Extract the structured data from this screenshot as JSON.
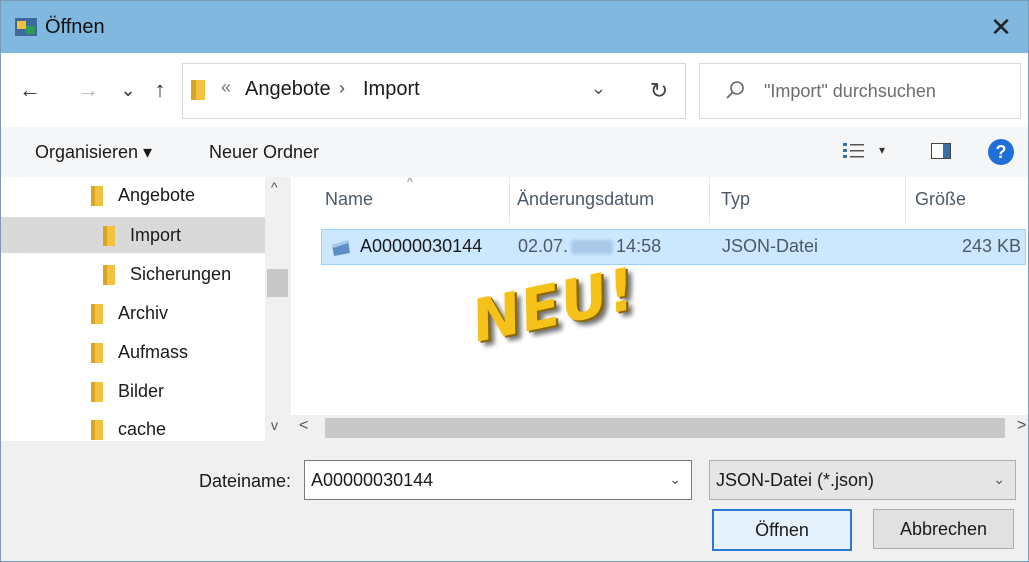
{
  "window": {
    "title": "Öffnen",
    "close_glyph": "✕"
  },
  "addressbar": {
    "back": "←",
    "forward": "→",
    "recent": "⌄",
    "up": "↑",
    "overflow": "«",
    "path": [
      "Angebote",
      "Import"
    ],
    "separator": "›",
    "dropdown": "⌄",
    "refresh": "↻",
    "search_placeholder": "\"Import\" durchsuchen"
  },
  "toolbar": {
    "organize": "Organisieren ▾",
    "new_folder": "Neuer Ordner",
    "view_caret": "▾",
    "help": "?"
  },
  "navpane": {
    "items": [
      {
        "label": "Angebote",
        "selected": false
      },
      {
        "label": "Import",
        "selected": true
      },
      {
        "label": "Sicherungen",
        "selected": false
      },
      {
        "label": "Archiv",
        "selected": false
      },
      {
        "label": "Aufmass",
        "selected": false
      },
      {
        "label": "Bilder",
        "selected": false
      },
      {
        "label": "cache",
        "selected": false
      }
    ],
    "scroll_up": "^",
    "scroll_down": "v"
  },
  "filelist": {
    "columns": [
      "Name",
      "Änderungsdatum",
      "Typ",
      "Größe"
    ],
    "sort_caret": "^",
    "rows": [
      {
        "name": "A00000030144",
        "date_start": "02.07.",
        "time": "14:58",
        "type": "JSON-Datei",
        "size": "243 KB"
      }
    ],
    "scroll_left": "<",
    "scroll_right": ">"
  },
  "overlay": {
    "stamp_text": "NEU!"
  },
  "bottom": {
    "filename_label": "Dateiname:",
    "filename_value": "A00000030144",
    "filetype_value": "JSON-Datei (*.json)",
    "dropdown": "⌄",
    "open_label": "Öffnen",
    "cancel_label": "Abbrechen"
  },
  "colors": {
    "titlebar": "#80b8e0",
    "selection": "#cce8ff",
    "folder": "#f2c343",
    "stamp": "#f6c21a",
    "help": "#1e6fd8"
  }
}
